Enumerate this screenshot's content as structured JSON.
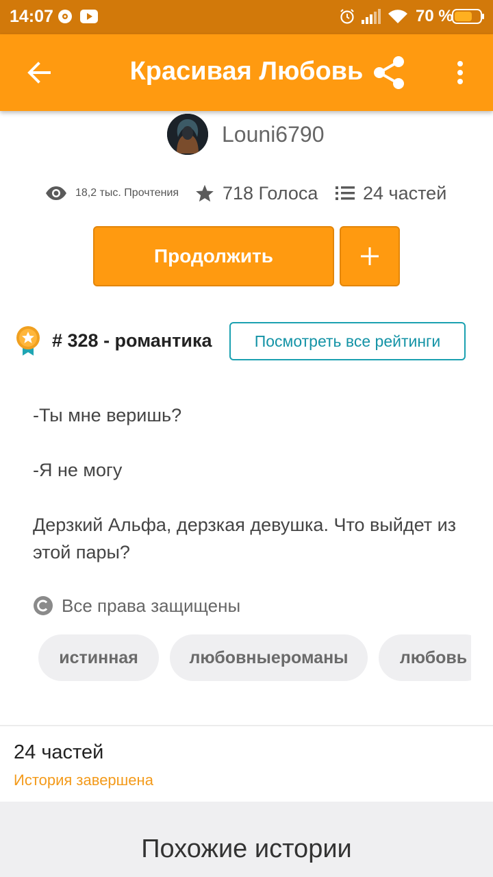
{
  "status_bar": {
    "time": "14:07",
    "battery_percent": "70 %",
    "battery_level": 0.7,
    "icons": [
      "podcast-icon",
      "youtube-icon",
      "alarm-icon",
      "signal-icon",
      "wifi-icon",
      "battery-icon"
    ]
  },
  "app_bar": {
    "title": "Красивая Любовь",
    "icons": [
      "back-arrow-icon",
      "share-icon",
      "more-vert-icon"
    ]
  },
  "author": {
    "name": "Louni6790"
  },
  "stats": {
    "reads": "18,2 тыс. Прочтения",
    "votes": "718 Голоса",
    "parts": "24 частей"
  },
  "actions": {
    "continue_label": "Продолжить",
    "add_label": "+"
  },
  "ranking": {
    "text": "# 328 - романтика",
    "view_all_label": "Посмотреть все рейтинги"
  },
  "description": {
    "line1": "-Ты мне веришь?",
    "line2": "-Я не могу",
    "line3": "Дерзкий Альфа, дерзкая девушка. Что выйдет из этой пары?"
  },
  "copyright": "Все права защищены",
  "tags": [
    "истинная",
    "любовныероманы",
    "любовь"
  ],
  "story_info": {
    "parts": "24 частей",
    "status": "История завершена"
  },
  "similar": {
    "title": "Похожие истории"
  },
  "colors": {
    "accent": "#ff9a10",
    "status_bar": "#d2790a",
    "link": "#1493a6",
    "status_text": "#f39a1a"
  }
}
